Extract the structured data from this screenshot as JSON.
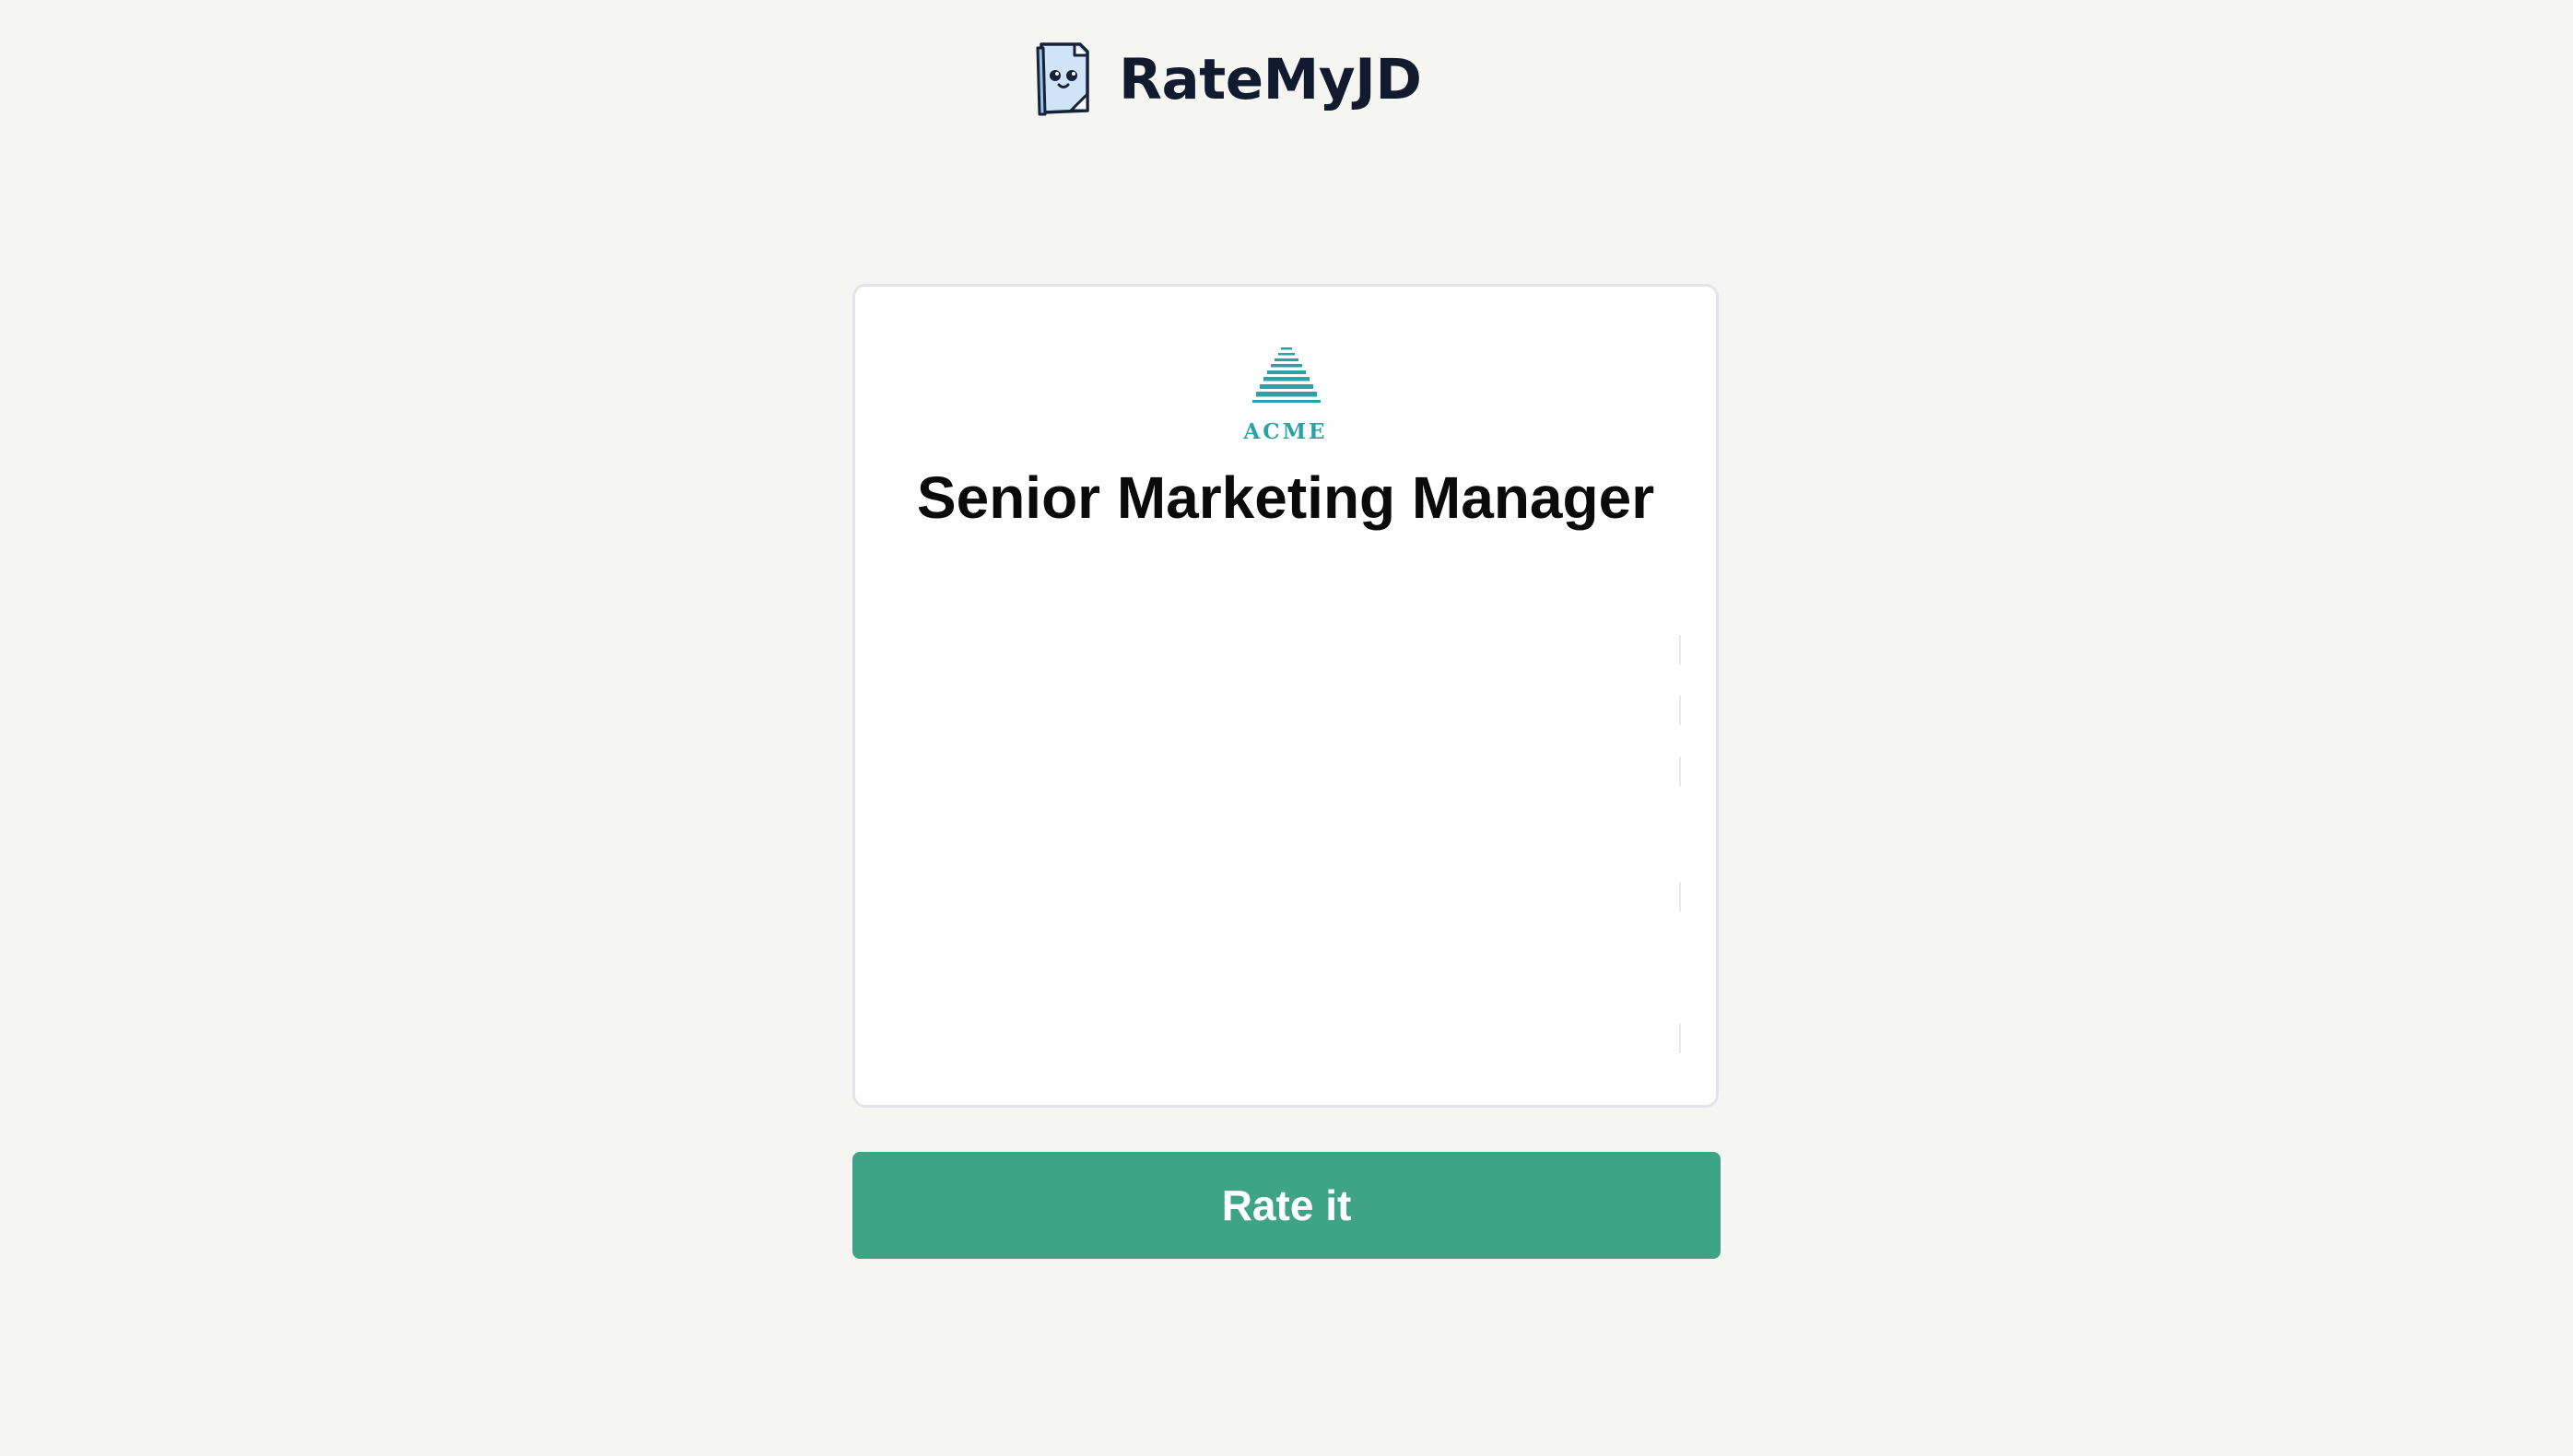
{
  "header": {
    "app_name": "RateMyJD",
    "logo_icon": "document-mascot-icon"
  },
  "job": {
    "company_name": "ACME",
    "company_logo_icon": "acme-pyramid-logo",
    "title": "Senior Marketing Manager"
  },
  "actions": {
    "rate_label": "Rate it"
  },
  "colors": {
    "background": "#f5f5f2",
    "primary_button": "#3ea485",
    "brand_text": "#111a2e",
    "logo_teal": "#2ba3a6"
  }
}
